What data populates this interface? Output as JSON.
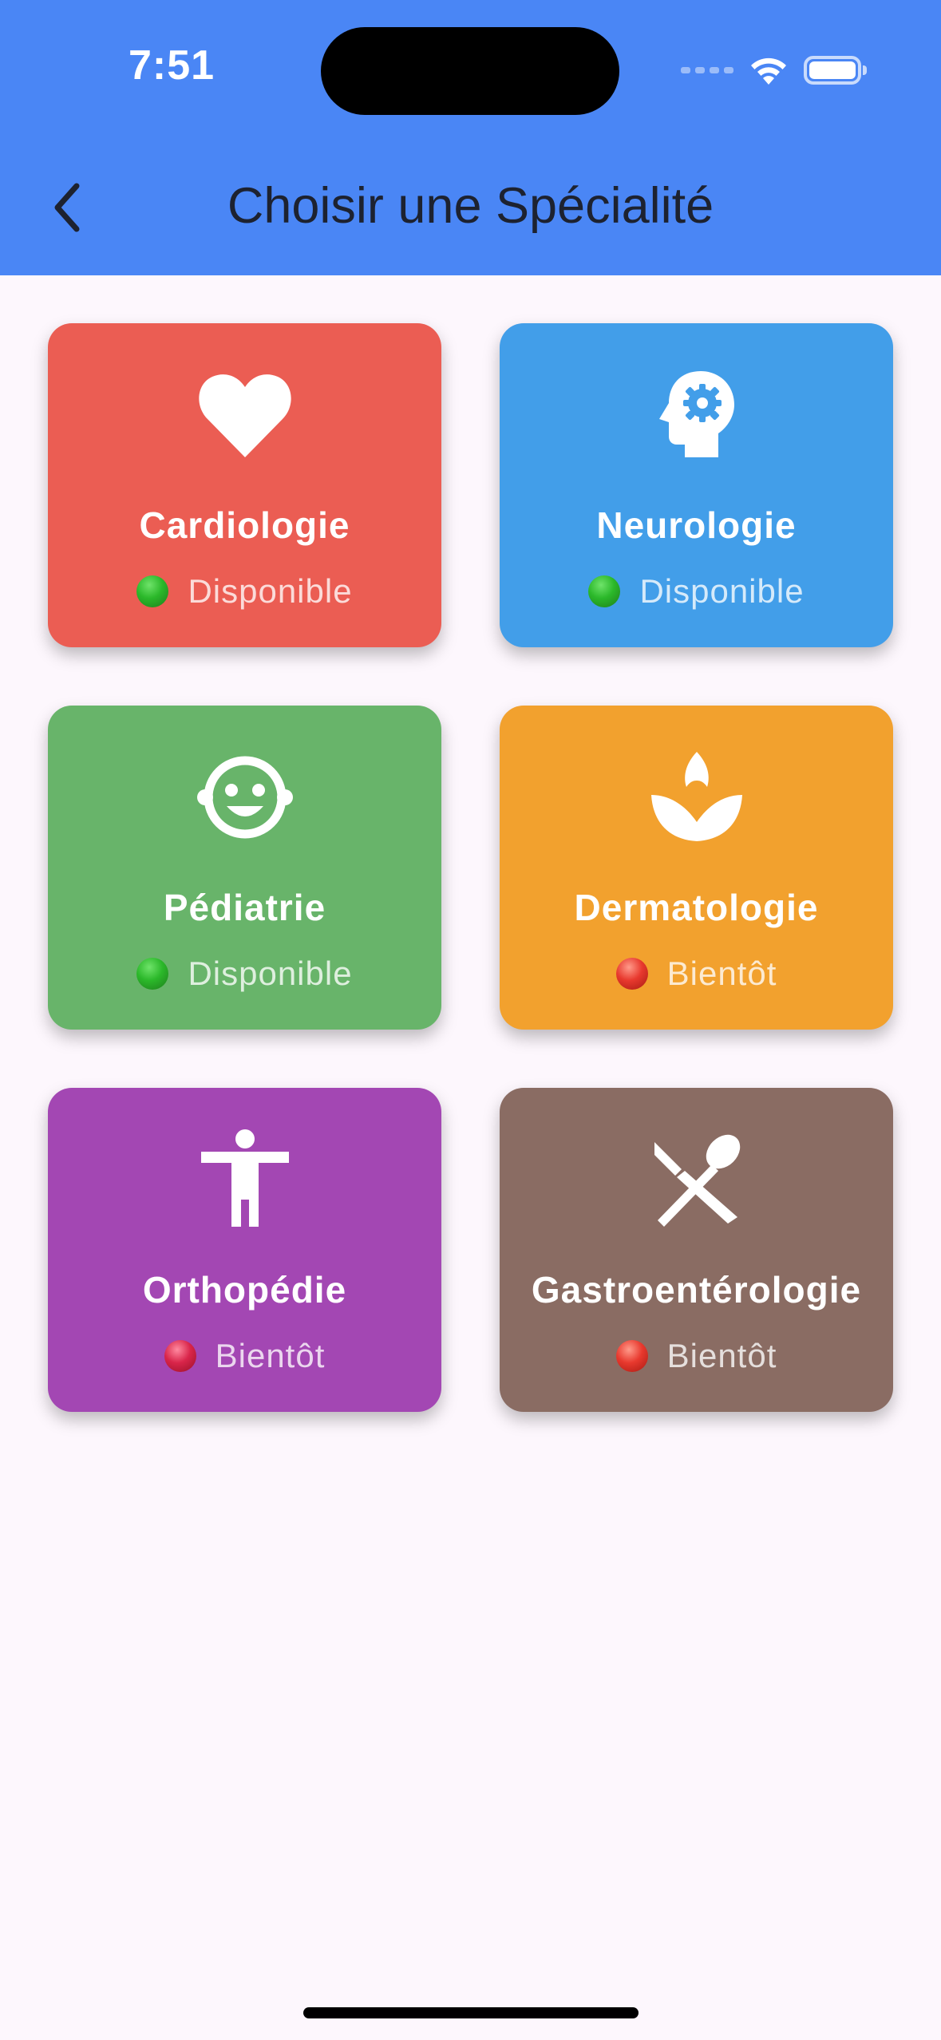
{
  "status_bar": {
    "time": "7:51",
    "icons": [
      "cellular-icon",
      "wifi-icon",
      "battery-icon"
    ]
  },
  "header": {
    "title": "Choisir une Spécialité",
    "back_icon": "chevron-left-icon",
    "background_color": "#4a86f5"
  },
  "specialties": [
    {
      "name": "Cardiologie",
      "status": "Disponible",
      "status_color": "green",
      "color": "#eb5d53",
      "icon": "heart-icon"
    },
    {
      "name": "Neurologie",
      "status": "Disponible",
      "status_color": "green",
      "color": "#429ee9",
      "icon": "psychology-head-icon"
    },
    {
      "name": "Pédiatrie",
      "status": "Disponible",
      "status_color": "green",
      "color": "#68b46a",
      "icon": "baby-face-icon"
    },
    {
      "name": "Dermatologie",
      "status": "Bientôt",
      "status_color": "red",
      "color": "#f2a12e",
      "icon": "spa-leaf-icon"
    },
    {
      "name": "Orthopédie",
      "status": "Bientôt",
      "status_color": "red",
      "color": "#a347b3",
      "icon": "accessibility-person-icon"
    },
    {
      "name": "Gastroentérologie",
      "status": "Bientôt",
      "status_color": "red",
      "color": "#8a6c63",
      "icon": "fork-spoon-icon"
    }
  ]
}
